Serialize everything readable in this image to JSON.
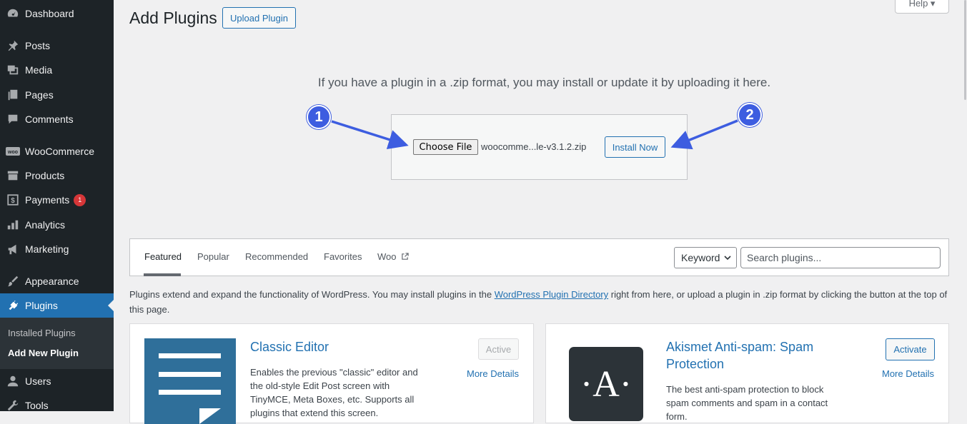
{
  "sidebar": {
    "items": [
      {
        "label": "Dashboard",
        "icon": "dashboard-icon"
      },
      {
        "label": "Posts",
        "icon": "pin-icon"
      },
      {
        "label": "Media",
        "icon": "media-icon"
      },
      {
        "label": "Pages",
        "icon": "pages-icon"
      },
      {
        "label": "Comments",
        "icon": "comment-icon"
      },
      {
        "label": "WooCommerce",
        "icon": "woo-icon"
      },
      {
        "label": "Products",
        "icon": "archive-icon"
      },
      {
        "label": "Payments",
        "icon": "dollar-icon",
        "badge": "1"
      },
      {
        "label": "Analytics",
        "icon": "bar-chart-icon"
      },
      {
        "label": "Marketing",
        "icon": "megaphone-icon"
      },
      {
        "label": "Appearance",
        "icon": "brush-icon"
      },
      {
        "label": "Plugins",
        "icon": "plug-icon"
      },
      {
        "label": "Users",
        "icon": "users-icon"
      },
      {
        "label": "Tools",
        "icon": "wrench-icon"
      }
    ],
    "submenu": [
      "Installed Plugins",
      "Add New Plugin"
    ]
  },
  "header": {
    "title": "Add Plugins",
    "upload_button": "Upload Plugin",
    "help": "Help ▾"
  },
  "upload": {
    "instruction": "If you have a plugin in a .zip format, you may install or update it by uploading it here.",
    "choose_file_label": "Choose File",
    "file_name": "woocomme...le-v3.1.2.zip",
    "install_label": "Install Now",
    "step1": "1",
    "step2": "2"
  },
  "filter": {
    "tabs": [
      "Featured",
      "Popular",
      "Recommended",
      "Favorites",
      "Woo"
    ],
    "keyword": "Keyword",
    "search_placeholder": "Search plugins..."
  },
  "intro": {
    "before": "Plugins extend and expand the functionality of WordPress. You may install plugins in the ",
    "link": "WordPress Plugin Directory",
    "after": " right from here, or upload a plugin in .zip format by clicking the button at the top of this page."
  },
  "plugins": [
    {
      "title": "Classic Editor",
      "description": "Enables the previous \"classic\" editor and the old-style Edit Post screen with TinyMCE, Meta Boxes, etc. Supports all plugins that extend this screen.",
      "action": "Active",
      "more": "More Details"
    },
    {
      "title": "Akismet Anti-spam: Spam Protection",
      "description": "The best anti-spam protection to block spam comments and spam in a contact form.",
      "action": "Activate",
      "more": "More Details",
      "logo_letter": "·A·"
    }
  ],
  "colors": {
    "sidebar_bg": "#1d2327",
    "accent": "#2271b1",
    "callout": "#3d5de0",
    "badge": "#d63638"
  }
}
